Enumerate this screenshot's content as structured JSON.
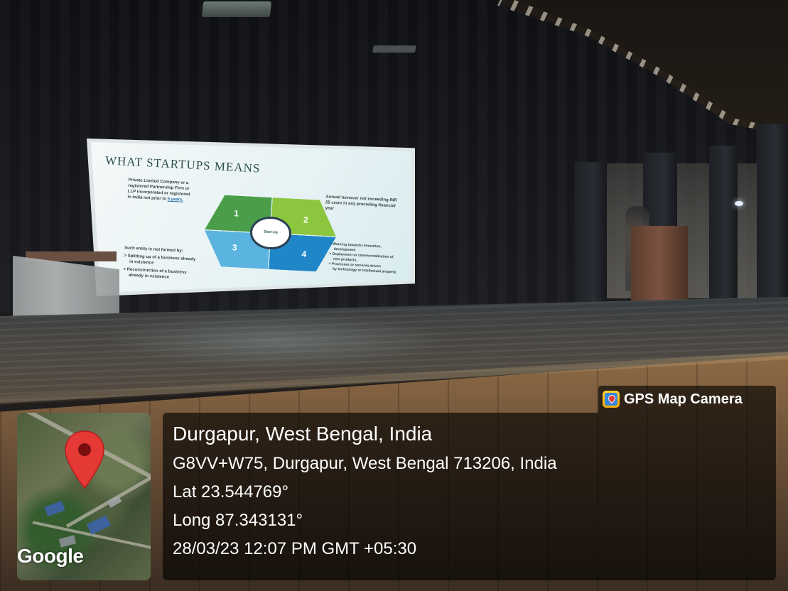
{
  "slide": {
    "title": "WHAT STARTUPS MEANS",
    "left_text_1": "Private Limited Company or a",
    "left_text_2": "registered Partnership Firm or",
    "left_text_3": "LLP incorporated or registered",
    "left_text_4": "in India not prior to",
    "left_text_4_highlight": "5 years.",
    "right_text_1": "Annual turnover not exceeding INR",
    "right_text_2": "25 crore in any preceding financial",
    "right_text_3": "year",
    "bottom_heading": "Such entity is not formed by:",
    "bottom_1a": "Splitting up of a business already",
    "bottom_1b": "in existence",
    "bottom_2a": "Reconstruction of a business",
    "bottom_2b": "already in existence",
    "right_bullet_1a": "Working towards innovation,",
    "right_bullet_1b": "development",
    "right_bullet_2a": "Deployment or commercialization of",
    "right_bullet_2b": "new products,",
    "right_bullet_3a": "Processes or services driven",
    "right_bullet_3b": "by technology or intellectual property",
    "hex_numbers": [
      "1",
      "2",
      "3",
      "4"
    ],
    "hex_center": "Start-Up",
    "hex_colors": [
      "#4b9e49",
      "#8cc63f",
      "#5bb3e0",
      "#1f86c8"
    ]
  },
  "gps_overlay": {
    "brand_label": "GPS Map Camera",
    "brand_icon": "gps-map-camera-icon",
    "map_watermark": "Google",
    "map_pin_color": "#e53935",
    "city": "Durgapur, West Bengal, India",
    "address": "G8VV+W75, Durgapur, West Bengal 713206, India",
    "latitude": "Lat 23.544769°",
    "longitude": "Long 87.343131°",
    "datetime": "28/03/23 12:07 PM GMT +05:30"
  }
}
